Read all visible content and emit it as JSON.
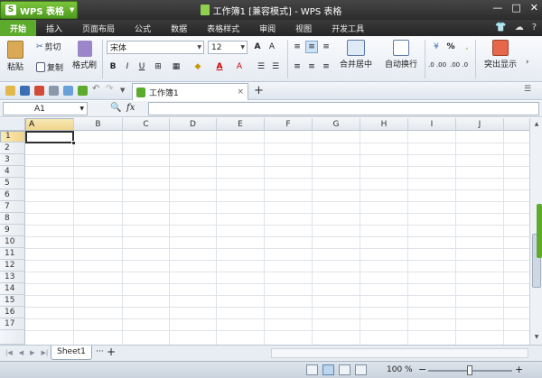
{
  "titlebar": {
    "app_button_label": "WPS 表格",
    "app_logo": "S",
    "window_title": "工作簿1 [兼容模式] - WPS 表格",
    "controls": {
      "minimize": "—",
      "maximize": "□",
      "close": "✕"
    }
  },
  "menu": {
    "tabs": [
      "开始",
      "插入",
      "页面布局",
      "公式",
      "数据",
      "表格样式",
      "审阅",
      "视图",
      "开发工具"
    ],
    "active_index": 0,
    "right_icons": [
      "shirt-icon",
      "cloud-icon",
      "help-icon"
    ],
    "help_label": "?"
  },
  "ribbon": {
    "paste": "粘贴",
    "cut": "剪切",
    "copy": "复制",
    "format_painter": "格式刷",
    "font_name": "宋体",
    "font_size": "12",
    "bold": "B",
    "italic": "I",
    "underline": "U",
    "merge_center": "合并居中",
    "wrap_text": "自动换行",
    "percent": "%",
    "number_inc": ".0 .00",
    "number_dec": ".00 .0",
    "highlight": "突出显示",
    "font_color_label": "A",
    "accent_color": "#5cab2c"
  },
  "quickaccess": {
    "doc_tab": "工作簿1",
    "doc_tab_close": "×",
    "new_tab": "+"
  },
  "formula_bar": {
    "cell_ref": "A1",
    "fx": "fx",
    "formula": ""
  },
  "grid": {
    "columns": [
      "A",
      "B",
      "C",
      "D",
      "E",
      "F",
      "G",
      "H",
      "I",
      "J"
    ],
    "rows": [
      "1",
      "2",
      "3",
      "4",
      "5",
      "6",
      "7",
      "8",
      "9",
      "10",
      "11",
      "12",
      "13",
      "14",
      "15",
      "16",
      "17"
    ],
    "active_cell": "A1"
  },
  "sheets": {
    "tabs": [
      "Sheet1"
    ],
    "more": "···",
    "add": "+"
  },
  "status": {
    "zoom": "100 %",
    "zoom_minus": "−",
    "zoom_plus": "+"
  }
}
